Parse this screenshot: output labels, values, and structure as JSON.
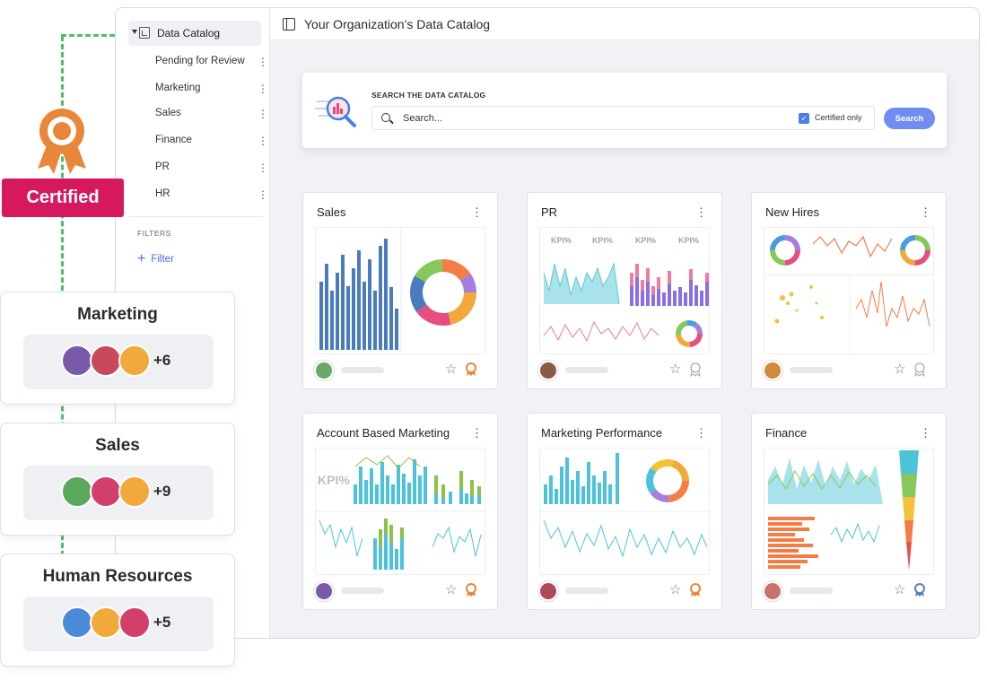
{
  "window": {
    "title": "Your Organization’s Data Catalog"
  },
  "sidebar": {
    "root": "Data Catalog",
    "items": [
      {
        "label": "Pending for Review"
      },
      {
        "label": "Marketing"
      },
      {
        "label": "Sales"
      },
      {
        "label": "Finance"
      },
      {
        "label": "PR"
      },
      {
        "label": "HR"
      }
    ],
    "filters_title": "FILTERS",
    "filter_button": "Filter"
  },
  "search": {
    "title": "SEARCH THE DATA CATALOG",
    "placeholder": "Search...",
    "checkbox_label": "Certified only",
    "button": "Search"
  },
  "cards": [
    {
      "title": "Sales"
    },
    {
      "title": "PR"
    },
    {
      "title": "New Hires"
    },
    {
      "title": "Account Based Marketing"
    },
    {
      "title": "Marketing Performance"
    },
    {
      "title": "Finance"
    }
  ],
  "certified_label": "Certified",
  "teams": [
    {
      "name": "Marketing",
      "more": "+6"
    },
    {
      "name": "Sales",
      "more": "+9"
    },
    {
      "name": "Human Resources",
      "more": "+5"
    }
  ],
  "colors": {
    "certified": "#d6185f",
    "accent": "#6f8df0",
    "dashed_line": "#4cc06a",
    "ribbon": "#e8873a"
  }
}
